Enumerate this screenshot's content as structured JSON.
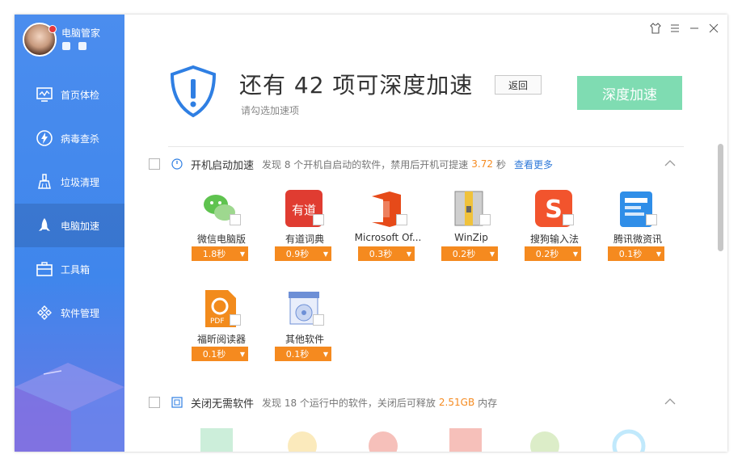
{
  "profile": {
    "name": "电脑管家"
  },
  "nav": {
    "items": [
      {
        "label": "首页体检",
        "icon": "monitor-icon"
      },
      {
        "label": "病毒查杀",
        "icon": "lightning-icon"
      },
      {
        "label": "垃圾清理",
        "icon": "broom-icon"
      },
      {
        "label": "电脑加速",
        "icon": "rocket-icon",
        "active": true
      },
      {
        "label": "工具箱",
        "icon": "toolbox-icon"
      },
      {
        "label": "软件管理",
        "icon": "apps-icon"
      }
    ]
  },
  "header": {
    "title": "还有 42 项可深度加速",
    "subtitle": "请勾选加速项",
    "back_label": "返回",
    "accelerate_label": "深度加速"
  },
  "startup_section": {
    "title": "开机启动加速",
    "desc_prefix": "发现 8 个开机自启动的软件，禁用后开机可提速",
    "value": "3.72",
    "unit": "秒",
    "more_label": "查看更多",
    "apps": [
      {
        "name": "微信电脑版",
        "time": "1.8秒",
        "icon": "wechat-icon"
      },
      {
        "name": "有道词典",
        "time": "0.9秒",
        "icon": "youdao-icon"
      },
      {
        "name": "Microsoft Of...",
        "time": "0.3秒",
        "icon": "office-icon"
      },
      {
        "name": "WinZip",
        "time": "0.2秒",
        "icon": "winzip-icon"
      },
      {
        "name": "搜狗输入法",
        "time": "0.2秒",
        "icon": "sogou-icon"
      },
      {
        "name": "腾讯微资讯",
        "time": "0.1秒",
        "icon": "tencent-news-icon"
      },
      {
        "name": "福昕阅读器",
        "time": "0.1秒",
        "icon": "foxit-icon"
      },
      {
        "name": "其他软件",
        "time": "0.1秒",
        "icon": "other-software-icon"
      }
    ]
  },
  "close_section": {
    "title": "关闭无需软件",
    "desc_prefix": "发现 18 个运行中的软件，关闭后可释放",
    "value": "2.51GB",
    "suffix": "内存"
  },
  "colors": {
    "sidebar": "#3f86ec",
    "accent_orange": "#f58a1f",
    "accel_button": "#7fdcb2",
    "link": "#2f79d8"
  }
}
